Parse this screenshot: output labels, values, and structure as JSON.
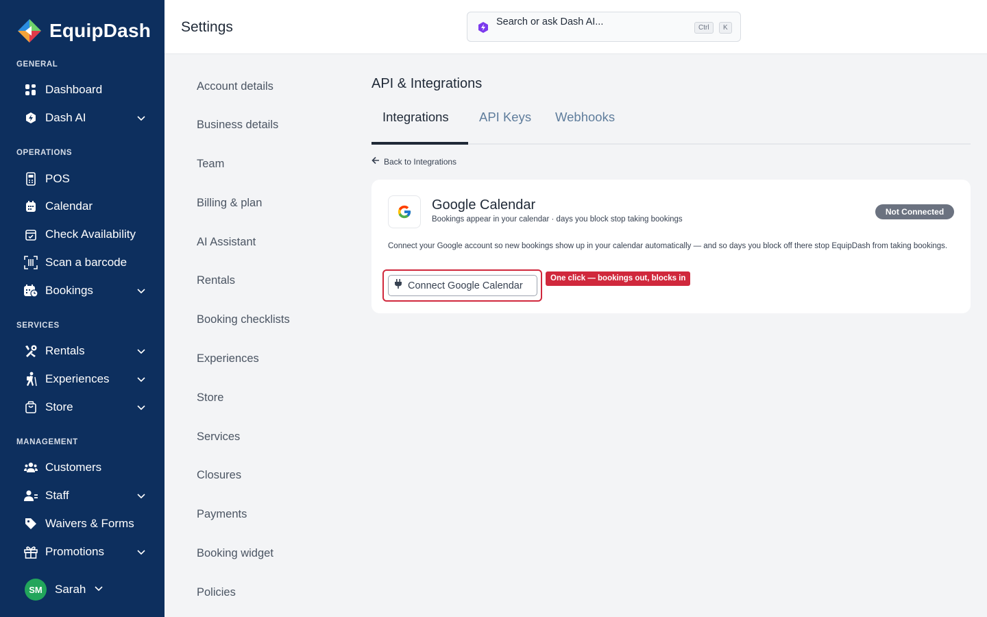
{
  "brand": {
    "name": "EquipDash"
  },
  "sidebar": {
    "sections": {
      "general": "GENERAL",
      "operations": "OPERATIONS",
      "services": "SERVICES",
      "management": "MANAGEMENT"
    },
    "items": {
      "dashboard": "Dashboard",
      "dash_ai": "Dash AI",
      "pos": "POS",
      "calendar": "Calendar",
      "check_availability": "Check Availability",
      "scan_barcode": "Scan a barcode",
      "bookings": "Bookings",
      "rentals": "Rentals",
      "experiences": "Experiences",
      "store": "Store",
      "customers": "Customers",
      "staff": "Staff",
      "waivers": "Waivers & Forms",
      "promotions": "Promotions"
    },
    "user": {
      "initials": "SM",
      "name": "Sarah"
    }
  },
  "header": {
    "title": "Settings",
    "search_placeholder": "Search or ask Dash AI...",
    "shortcut_ctrl": "Ctrl",
    "shortcut_key": "K"
  },
  "settings_menu": [
    "Account details",
    "Business details",
    "Team",
    "Billing & plan",
    "AI Assistant",
    "Rentals",
    "Booking checklists",
    "Experiences",
    "Store",
    "Services",
    "Closures",
    "Payments",
    "Booking widget",
    "Policies"
  ],
  "main": {
    "section_title": "API & Integrations",
    "tabs": [
      "Integrations",
      "API Keys",
      "Webhooks"
    ],
    "active_tab": "Integrations",
    "back_link": "Back to Integrations",
    "integration": {
      "name": "Google Calendar",
      "subtitle": "Bookings appear in your calendar · days you block stop taking bookings",
      "status": "Not Connected",
      "description": "Connect your Google account so new bookings show up in your calendar automatically — and so days you block off there stop EquipDash from taking bookings.",
      "connect_label": "Connect Google Calendar",
      "callout": "One click — bookings out, blocks in"
    }
  },
  "colors": {
    "sidebar_bg": "#0d2f5e",
    "accent_red": "#d0283c",
    "badge_gray": "#6b7280",
    "avatar_green": "#22a55b",
    "tab_inactive": "#5f7d9c"
  }
}
